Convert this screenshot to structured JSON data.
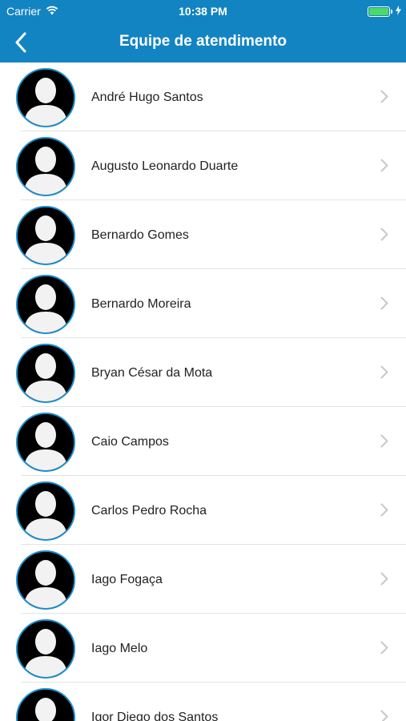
{
  "status_bar": {
    "carrier": "Carrier",
    "time": "10:38 PM"
  },
  "nav": {
    "title": "Equipe de atendimento"
  },
  "list": {
    "items": [
      {
        "name": "André Hugo Santos"
      },
      {
        "name": "Augusto Leonardo Duarte"
      },
      {
        "name": "Bernardo Gomes"
      },
      {
        "name": "Bernardo Moreira"
      },
      {
        "name": "Bryan César da Mota"
      },
      {
        "name": "Caio Campos"
      },
      {
        "name": "Carlos Pedro Rocha"
      },
      {
        "name": "Iago Fogaça"
      },
      {
        "name": "Iago Melo"
      },
      {
        "name": "Igor Diego dos Santos"
      }
    ]
  },
  "colors": {
    "nav_background": "#1384c2",
    "avatar_border": "#1a8fd0",
    "battery": "#4cd964"
  },
  "icons": {
    "back": "chevron-left-icon",
    "row_disclosure": "chevron-right-icon",
    "avatar": "person-silhouette-icon",
    "wifi": "wifi-icon",
    "battery": "battery-icon",
    "charging": "bolt-icon"
  }
}
